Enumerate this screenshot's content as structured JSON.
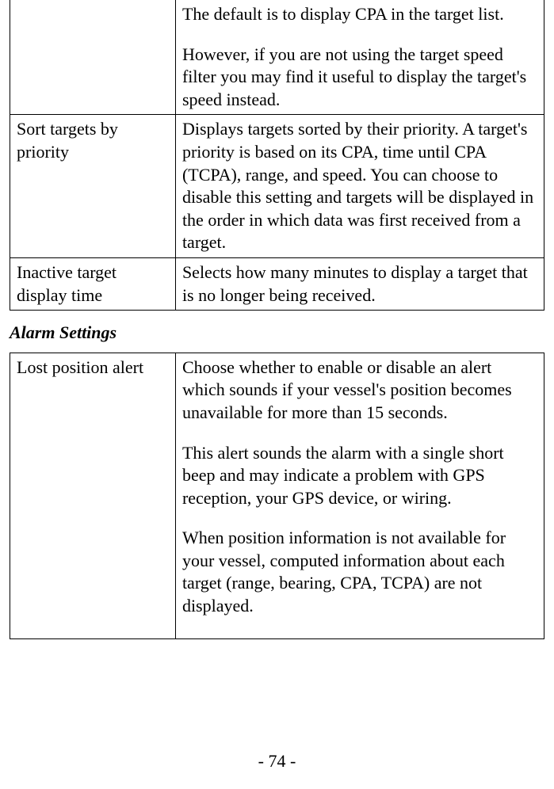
{
  "table1": {
    "rows": [
      {
        "label": "",
        "desc_p1": "The default is to display CPA in the target list.",
        "desc_p2": "However, if you are not using the target speed filter you may find it useful to display the target's speed instead."
      },
      {
        "label": "Sort targets by priority",
        "desc": "Displays targets sorted by their priority. A target's priority is based on its CPA, time until CPA (TCPA), range, and speed. You can choose to disable this setting and targets will be displayed in the order in which data was first received from a target."
      },
      {
        "label": "Inactive target display time",
        "desc": "Selects how many minutes to display a target that is no longer being received."
      }
    ]
  },
  "section_heading": "Alarm Settings",
  "table2": {
    "rows": [
      {
        "label": "Lost position alert",
        "desc_p1": "Choose whether to enable or disable an alert which sounds if your vessel's position becomes unavailable for more than 15 seconds.",
        "desc_p2": "This alert sounds the alarm with a single short beep and may indicate a problem with GPS reception, your GPS device, or wiring.",
        "desc_p3": "When position information is not available for your vessel, computed information about each target (range, bearing, CPA, TCPA) are not displayed."
      }
    ]
  },
  "page_number": "- 74 -"
}
